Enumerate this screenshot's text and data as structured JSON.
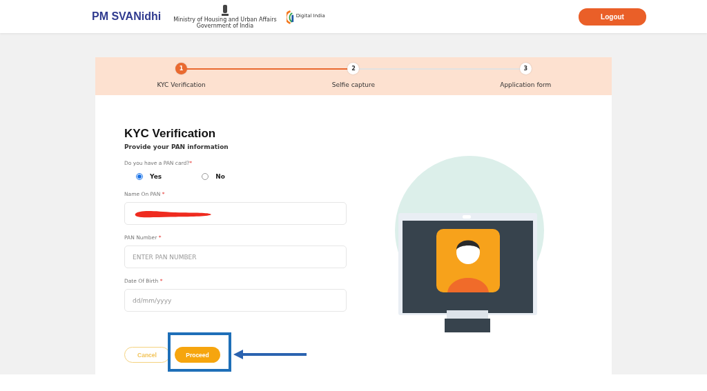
{
  "header": {
    "brand": "PM SVANidhi",
    "ministry": "Ministry of Housing and Urban Affairs",
    "government": "Government of India",
    "digital_india": "Digital India",
    "logout": "Logout"
  },
  "steps": [
    {
      "number": "1",
      "label": "KYC Verification",
      "selected": true
    },
    {
      "number": "2",
      "label": "Selfie capture",
      "selected": false
    },
    {
      "number": "3",
      "label": "Application form",
      "selected": false
    }
  ],
  "form": {
    "title": "KYC Verification",
    "subtitle": "Provide your PAN information",
    "question": "Do you have a PAN card?",
    "question_mark": "*",
    "options": [
      {
        "label": "Yes",
        "selected": true
      },
      {
        "label": "No",
        "selected": false
      }
    ],
    "fields": [
      {
        "label": "Name On PAN",
        "required_mark": "*",
        "kind": "redacted"
      },
      {
        "label": "PAN Number",
        "required_mark": "*",
        "kind": "text",
        "placeholder": "ENTER PAN NUMBER"
      },
      {
        "label": "Date Of Birth",
        "required_mark": "*",
        "kind": "text",
        "placeholder": "dd/mm/yyyy"
      }
    ],
    "buttons": [
      {
        "label": "Cancel",
        "kind": "outline"
      },
      {
        "label": "Proceed",
        "kind": "primary"
      }
    ]
  }
}
